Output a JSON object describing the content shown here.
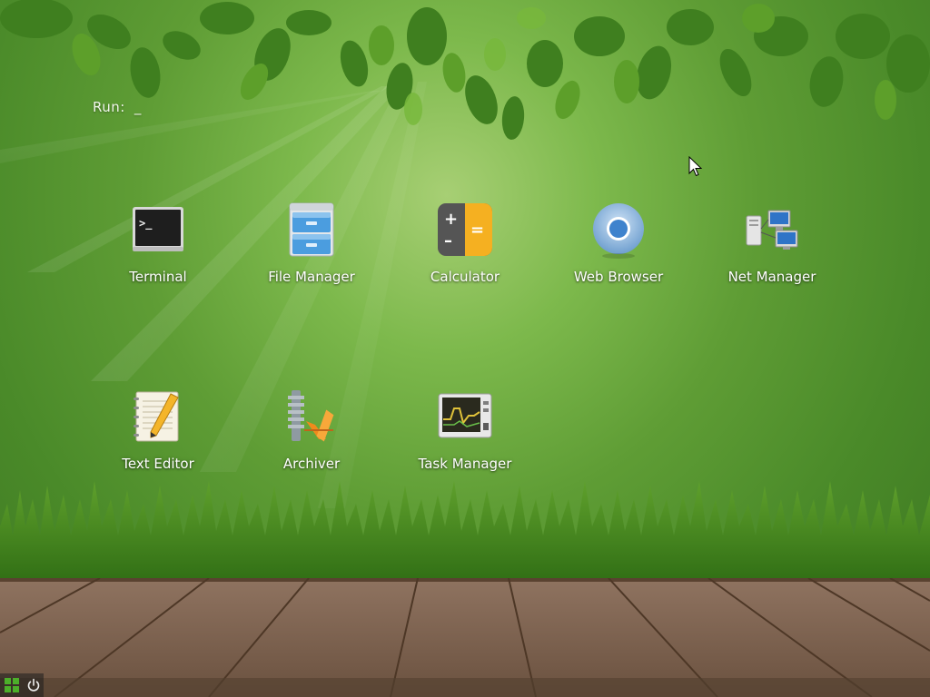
{
  "run_prompt": {
    "label": "Run:",
    "cursor": "_"
  },
  "desktop_icons": [
    {
      "label": "Terminal",
      "icon": "terminal-icon"
    },
    {
      "label": "File Manager",
      "icon": "file-manager-icon"
    },
    {
      "label": "Calculator",
      "icon": "calculator-icon"
    },
    {
      "label": "Web Browser",
      "icon": "web-browser-icon"
    },
    {
      "label": "Net Manager",
      "icon": "net-manager-icon"
    },
    {
      "label": "Text Editor",
      "icon": "text-editor-icon"
    },
    {
      "label": "Archiver",
      "icon": "archiver-icon"
    },
    {
      "label": "Task Manager",
      "icon": "task-manager-icon"
    }
  ],
  "icon_glyphs": {
    "terminal_prompt": ">_",
    "calc_plus": "+",
    "calc_minus": "–",
    "calc_equals": "="
  },
  "taskbar": {
    "menu_icon": "app-menu-icon",
    "power_icon": "power-icon"
  },
  "colors": {
    "accent_green": "#4caf2a",
    "calc_orange": "#f5b021",
    "label_text": "#ffffff"
  }
}
